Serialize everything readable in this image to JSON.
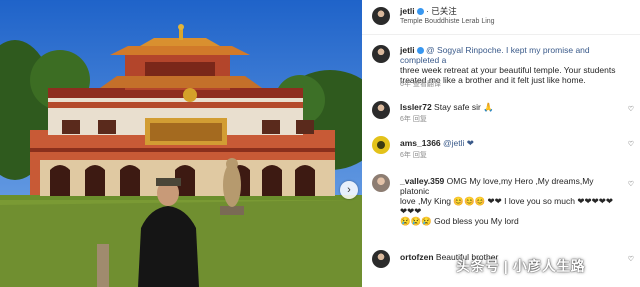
{
  "post": {
    "username": "jetli",
    "follow_label": "· 已关注",
    "location": "Temple Bouddhiste Lerab Ling",
    "caption_user": "jetli",
    "caption": "@ Sogyal Rinpoche. I kept my promise and completed a three week retreat at your beautiful temple. Your students treated me like a brother and it felt just like home.",
    "caption_lines": [
      "@ Sogyal Rinpoche. I kept my promise and completed a",
      "three week retreat at your beautiful temple. Your students",
      "treated me like a brother and it felt just like home."
    ],
    "caption_meta": "6年 查看翻译"
  },
  "comments": [
    {
      "user": "lssler72",
      "text": "Stay safe sir 🙏",
      "meta": "6年 回复",
      "avatar": "dark"
    },
    {
      "user": "ams_1366",
      "text": "@jetli ❤",
      "meta": "6年 回复",
      "avatar": "yellow"
    },
    {
      "user": "_valley.359",
      "text": "OMG My love,my Hero ,My dreams,My platonic",
      "text2": "love ,My King 😊😊😊 ❤❤ I love you so much ❤❤❤❤❤❤❤❤",
      "text3": "😢😢😢 God bless you My lord",
      "meta": "",
      "avatar": "light"
    },
    {
      "user": "ortofzen",
      "text": "Beautiful brother",
      "meta": "",
      "avatar": "dark"
    }
  ],
  "watermark": "头条号 | 小彦人生路",
  "icons": {
    "nav": "chevron-right-icon",
    "like": "heart-icon",
    "verified": "verified-badge-icon"
  }
}
